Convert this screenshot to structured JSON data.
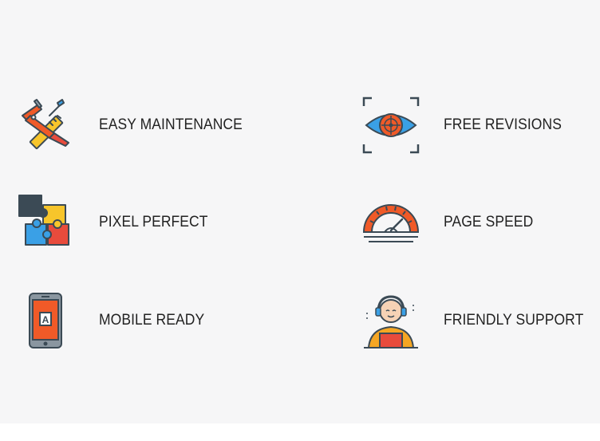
{
  "features": [
    {
      "label": "EASY MAINTENANCE",
      "icon": "tools-icon"
    },
    {
      "label": "FREE REVISIONS",
      "icon": "eye-target-icon"
    },
    {
      "label": "PIXEL PERFECT",
      "icon": "puzzle-icon"
    },
    {
      "label": "PAGE SPEED",
      "icon": "speedometer-icon"
    },
    {
      "label": "MOBILE READY",
      "icon": "mobile-phone-icon"
    },
    {
      "label": "FRIENDLY SUPPORT",
      "icon": "support-agent-icon"
    }
  ],
  "colors": {
    "background": "#f6f6f7",
    "text": "#222222",
    "outline": "#3b4a55",
    "orange": "#f05a28",
    "yellow": "#f7c52b",
    "blue": "#3aa0e6",
    "red": "#e84b3c"
  }
}
